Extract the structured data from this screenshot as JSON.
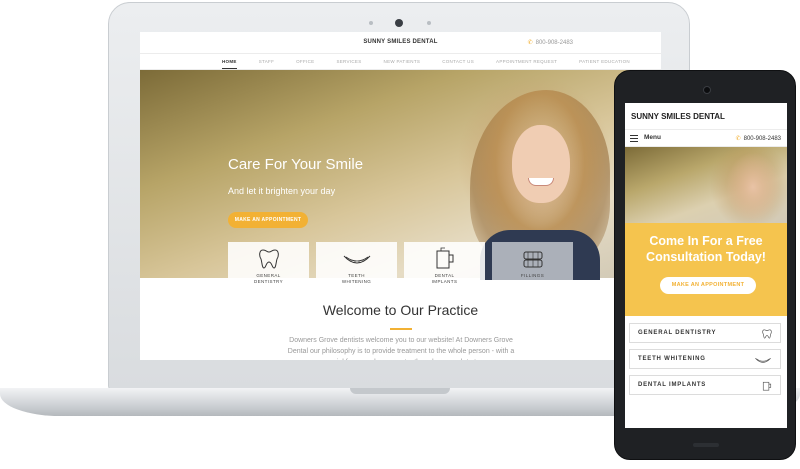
{
  "desktop": {
    "brand": "SUNNY SMILES DENTAL",
    "phone": "800-908-2483",
    "nav": [
      {
        "label": "HOME",
        "active": true
      },
      {
        "label": "STAFF"
      },
      {
        "label": "OFFICE"
      },
      {
        "label": "SERVICES"
      },
      {
        "label": "NEW PATIENTS"
      },
      {
        "label": "CONTACT US"
      },
      {
        "label": "APPOINTMENT REQUEST"
      },
      {
        "label": "PATIENT EDUCATION"
      }
    ],
    "hero": {
      "title": "Care For Your Smile",
      "subtitle": "And let it brighten your day",
      "button": "MAKE AN APPOINTMENT"
    },
    "services": [
      {
        "label": "GENERAL\nDENTISTRY",
        "icon": "tooth-icon"
      },
      {
        "label": "TEETH\nWHITENING",
        "icon": "smile-icon"
      },
      {
        "label": "DENTAL\nIMPLANTS",
        "icon": "cup-icon"
      },
      {
        "label": "FILLINGS",
        "icon": "braces-icon"
      }
    ],
    "welcome": {
      "title": "Welcome to Our Practice",
      "text": "Downers Grove dentists welcome you to our website! At Downers Grove Dental our philosophy is to provide treatment to the whole person - with a special focus on how your teeth and gums relate to"
    },
    "accent": "#f2b134"
  },
  "mobile": {
    "brand": "SUNNY SMILES DENTAL",
    "menu": "Menu",
    "phone": "800-908-2483",
    "cta_title": "Come In For a Free\nConsultation Today!",
    "cta_button": "MAKE AN APPOINTMENT",
    "services": [
      {
        "label": "GENERAL DENTISTRY",
        "icon": "tooth-icon"
      },
      {
        "label": "TEETH WHITENING",
        "icon": "smile-icon"
      },
      {
        "label": "DENTAL IMPLANTS",
        "icon": "cup-icon"
      }
    ],
    "cta_color": "#f5c44e"
  }
}
